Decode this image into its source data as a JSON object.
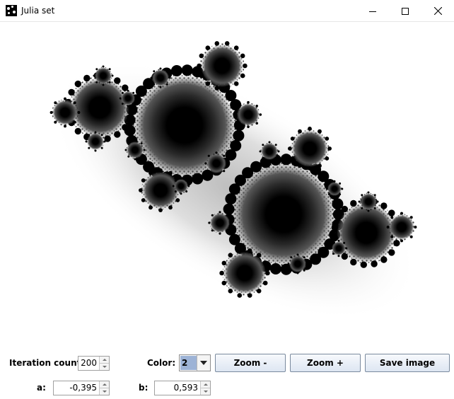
{
  "window": {
    "title": "Julia set",
    "app_icon": "julia-fractal-icon",
    "controls": [
      "minimize-icon",
      "maximize-icon",
      "close-icon"
    ]
  },
  "canvas": {
    "content": "Julia set fractal render, grayscale"
  },
  "controls": {
    "iteration_label": "Iteration count:",
    "iteration_value": "200",
    "color_label": "Color:",
    "color_value": "2",
    "zoom_out_label": "Zoom -",
    "zoom_in_label": "Zoom +",
    "save_label": "Save image",
    "a_label": "a:",
    "a_value": "-0,395",
    "b_label": "b:",
    "b_value": "0,593"
  }
}
